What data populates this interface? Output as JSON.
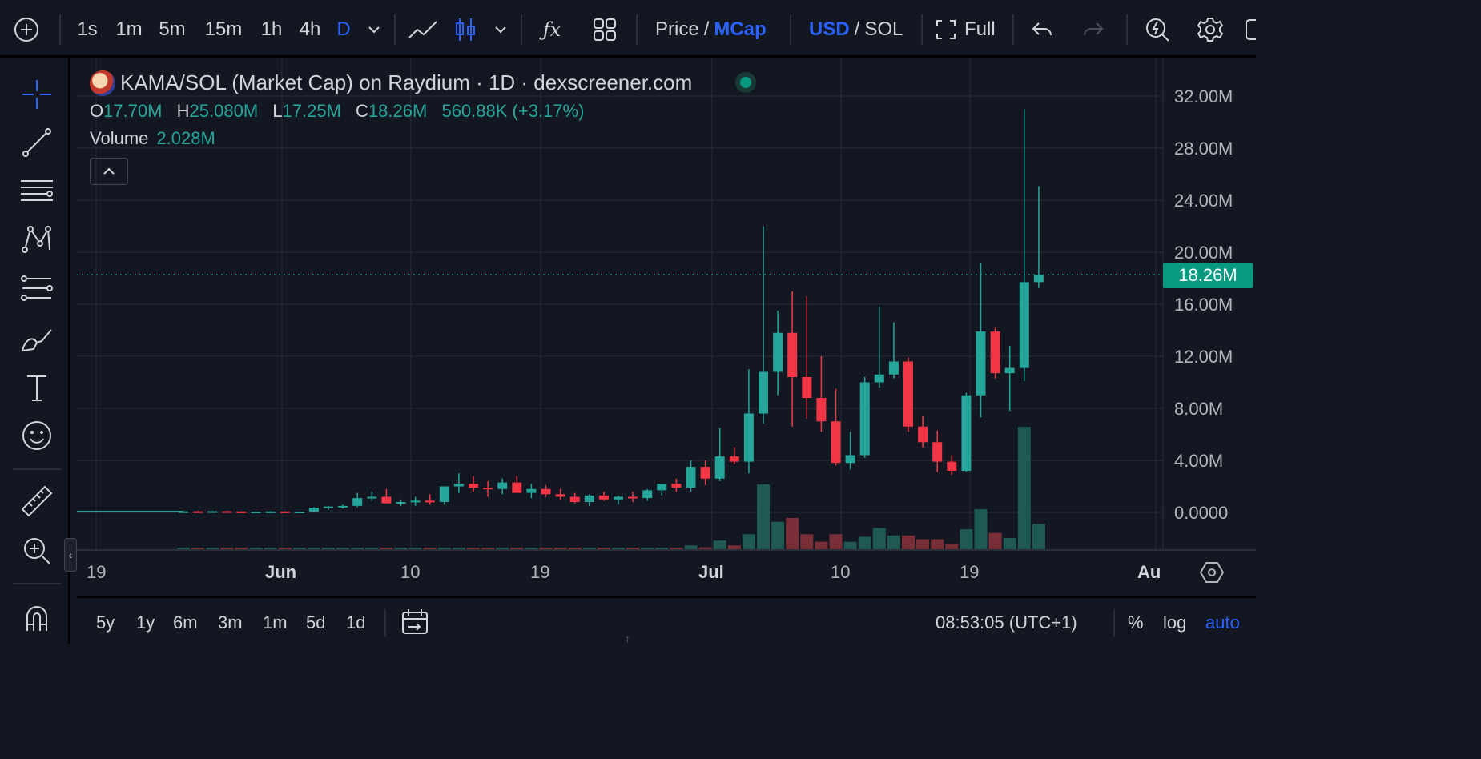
{
  "toolbar": {
    "intervals": [
      "1s",
      "1m",
      "5m",
      "15m",
      "1h",
      "4h",
      "D"
    ],
    "active_interval": "D",
    "price_label": "Price",
    "price_sep": "/",
    "mcap_label": "MCap",
    "usd_label": "USD",
    "sol_sep": "/",
    "sol_label": "SOL",
    "full_label": "Full"
  },
  "legend": {
    "title": "KAMA/SOL (Market Cap) on Raydium · 1D · dexscreener.com",
    "o_label": "O",
    "o_value": "17.70M",
    "h_label": "H",
    "h_value": "25.080M",
    "l_label": "L",
    "l_value": "17.25M",
    "c_label": "C",
    "c_value": "18.26M",
    "change": "560.88K (+3.17%)",
    "volume_label": "Volume",
    "volume_value": "2.028M"
  },
  "y_axis": [
    "32.00M",
    "28.00M",
    "24.00M",
    "20.00M",
    "16.00M",
    "12.00M",
    "8.00M",
    "4.00M",
    "0.0000"
  ],
  "last_price_tag": "18.26M",
  "x_axis": [
    {
      "label": "19",
      "bold": false
    },
    {
      "label": "Jun",
      "bold": true
    },
    {
      "label": "10",
      "bold": false
    },
    {
      "label": "19",
      "bold": false
    },
    {
      "label": "Jul",
      "bold": true
    },
    {
      "label": "10",
      "bold": false
    },
    {
      "label": "19",
      "bold": false
    },
    {
      "label": "Au",
      "bold": true
    }
  ],
  "bottom": {
    "ranges": [
      "5y",
      "1y",
      "6m",
      "3m",
      "1m",
      "5d",
      "1d"
    ],
    "time": "08:53:05 (UTC+1)",
    "percent": "%",
    "log": "log",
    "auto": "auto"
  },
  "colors": {
    "up": "#26a69a",
    "down": "#f23645",
    "accent": "#2962ff",
    "bg": "#131722"
  },
  "chart_data": {
    "type": "candlestick",
    "y_unit": "market cap (USD)",
    "ylim": [
      -3,
      33
    ],
    "candles": [
      {
        "o": 0.05,
        "h": 0.1,
        "l": 0.0,
        "c": 0.08,
        "v": 0.05
      },
      {
        "o": 0.08,
        "h": 0.12,
        "l": 0.03,
        "c": 0.06,
        "v": 0.04
      },
      {
        "o": 0.06,
        "h": 0.1,
        "l": 0.02,
        "c": 0.09,
        "v": 0.04
      },
      {
        "o": 0.09,
        "h": 0.12,
        "l": 0.05,
        "c": 0.07,
        "v": 0.03
      },
      {
        "o": 0.07,
        "h": 0.1,
        "l": 0.03,
        "c": 0.05,
        "v": 0.03
      },
      {
        "o": 0.05,
        "h": 0.08,
        "l": 0.02,
        "c": 0.06,
        "v": 0.03
      },
      {
        "o": 0.06,
        "h": 0.1,
        "l": 0.03,
        "c": 0.07,
        "v": 0.03
      },
      {
        "o": 0.07,
        "h": 0.1,
        "l": 0.04,
        "c": 0.05,
        "v": 0.03
      },
      {
        "o": 0.05,
        "h": 0.08,
        "l": 0.03,
        "c": 0.06,
        "v": 0.03
      },
      {
        "o": 0.06,
        "h": 0.4,
        "l": 0.0,
        "c": 0.35,
        "v": 0.06
      },
      {
        "o": 0.35,
        "h": 0.5,
        "l": 0.2,
        "c": 0.45,
        "v": 0.05
      },
      {
        "o": 0.45,
        "h": 0.6,
        "l": 0.3,
        "c": 0.5,
        "v": 0.04
      },
      {
        "o": 0.5,
        "h": 1.5,
        "l": 0.4,
        "c": 1.1,
        "v": 0.08
      },
      {
        "o": 1.1,
        "h": 1.6,
        "l": 0.9,
        "c": 1.2,
        "v": 0.06
      },
      {
        "o": 1.2,
        "h": 1.8,
        "l": 0.7,
        "c": 0.7,
        "v": 0.05
      },
      {
        "o": 0.7,
        "h": 1.0,
        "l": 0.5,
        "c": 0.8,
        "v": 0.04
      },
      {
        "o": 0.8,
        "h": 1.2,
        "l": 0.5,
        "c": 0.9,
        "v": 0.04
      },
      {
        "o": 0.9,
        "h": 1.4,
        "l": 0.6,
        "c": 0.8,
        "v": 0.03
      },
      {
        "o": 0.8,
        "h": 1.5,
        "l": 0.6,
        "c": 2.0,
        "v": 0.09
      },
      {
        "o": 2.0,
        "h": 3.0,
        "l": 1.5,
        "c": 2.2,
        "v": 0.12
      },
      {
        "o": 2.2,
        "h": 2.8,
        "l": 1.6,
        "c": 1.9,
        "v": 0.08
      },
      {
        "o": 1.9,
        "h": 2.4,
        "l": 1.2,
        "c": 1.8,
        "v": 0.06
      },
      {
        "o": 1.8,
        "h": 2.6,
        "l": 1.4,
        "c": 2.3,
        "v": 0.07
      },
      {
        "o": 2.3,
        "h": 2.8,
        "l": 1.7,
        "c": 1.5,
        "v": 0.05
      },
      {
        "o": 1.5,
        "h": 2.2,
        "l": 1.1,
        "c": 1.8,
        "v": 0.05
      },
      {
        "o": 1.8,
        "h": 2.1,
        "l": 1.2,
        "c": 1.4,
        "v": 0.04
      },
      {
        "o": 1.4,
        "h": 1.8,
        "l": 1.0,
        "c": 1.2,
        "v": 0.04
      },
      {
        "o": 1.2,
        "h": 1.5,
        "l": 0.7,
        "c": 0.8,
        "v": 0.04
      },
      {
        "o": 0.8,
        "h": 1.4,
        "l": 0.5,
        "c": 1.3,
        "v": 0.06
      },
      {
        "o": 1.3,
        "h": 1.6,
        "l": 0.9,
        "c": 1.0,
        "v": 0.04
      },
      {
        "o": 1.0,
        "h": 1.3,
        "l": 0.6,
        "c": 1.2,
        "v": 0.04
      },
      {
        "o": 1.2,
        "h": 1.6,
        "l": 0.8,
        "c": 1.1,
        "v": 0.04
      },
      {
        "o": 1.1,
        "h": 1.8,
        "l": 0.9,
        "c": 1.7,
        "v": 0.07
      },
      {
        "o": 1.7,
        "h": 2.2,
        "l": 1.3,
        "c": 2.2,
        "v": 0.08
      },
      {
        "o": 2.2,
        "h": 2.6,
        "l": 1.6,
        "c": 1.9,
        "v": 0.06
      },
      {
        "o": 1.9,
        "h": 4.0,
        "l": 1.6,
        "c": 3.5,
        "v": 0.3
      },
      {
        "o": 3.5,
        "h": 4.0,
        "l": 2.1,
        "c": 2.6,
        "v": 0.15
      },
      {
        "o": 2.6,
        "h": 6.5,
        "l": 2.4,
        "c": 4.3,
        "v": 0.7
      },
      {
        "o": 4.3,
        "h": 5.0,
        "l": 3.7,
        "c": 3.9,
        "v": 0.3
      },
      {
        "o": 3.9,
        "h": 11.0,
        "l": 3.0,
        "c": 7.6,
        "v": 1.2
      },
      {
        "o": 7.6,
        "h": 22.0,
        "l": 6.8,
        "c": 10.8,
        "v": 5.2
      },
      {
        "o": 10.8,
        "h": 15.5,
        "l": 9.0,
        "c": 13.8,
        "v": 2.2
      },
      {
        "o": 13.8,
        "h": 17.0,
        "l": 6.6,
        "c": 10.4,
        "v": 2.5
      },
      {
        "o": 10.4,
        "h": 16.6,
        "l": 7.2,
        "c": 8.8,
        "v": 1.2
      },
      {
        "o": 8.8,
        "h": 12.0,
        "l": 6.2,
        "c": 7.0,
        "v": 0.6
      },
      {
        "o": 7.0,
        "h": 9.5,
        "l": 3.6,
        "c": 3.8,
        "v": 1.2
      },
      {
        "o": 3.8,
        "h": 6.2,
        "l": 3.3,
        "c": 4.4,
        "v": 0.6
      },
      {
        "o": 4.4,
        "h": 10.4,
        "l": 4.2,
        "c": 10.0,
        "v": 1.0
      },
      {
        "o": 10.0,
        "h": 15.8,
        "l": 9.6,
        "c": 10.6,
        "v": 1.7
      },
      {
        "o": 10.6,
        "h": 14.6,
        "l": 10.3,
        "c": 11.6,
        "v": 1.1
      },
      {
        "o": 11.6,
        "h": 11.9,
        "l": 6.2,
        "c": 6.6,
        "v": 1.1
      },
      {
        "o": 6.6,
        "h": 7.4,
        "l": 5.0,
        "c": 5.4,
        "v": 0.8
      },
      {
        "o": 5.4,
        "h": 6.3,
        "l": 3.1,
        "c": 3.9,
        "v": 0.8
      },
      {
        "o": 3.9,
        "h": 4.4,
        "l": 2.9,
        "c": 3.2,
        "v": 0.4
      },
      {
        "o": 3.2,
        "h": 9.2,
        "l": 3.1,
        "c": 9.0,
        "v": 1.6
      },
      {
        "o": 9.0,
        "h": 19.2,
        "l": 7.3,
        "c": 13.9,
        "v": 3.2
      },
      {
        "o": 13.9,
        "h": 14.2,
        "l": 10.3,
        "c": 10.7,
        "v": 1.3
      },
      {
        "o": 10.7,
        "h": 12.8,
        "l": 7.8,
        "c": 11.1,
        "v": 0.9
      },
      {
        "o": 11.1,
        "h": 31.0,
        "l": 10.1,
        "c": 17.7,
        "v": 9.8
      },
      {
        "o": 17.7,
        "h": 25.08,
        "l": 17.25,
        "c": 18.26,
        "v": 2.028
      }
    ]
  }
}
